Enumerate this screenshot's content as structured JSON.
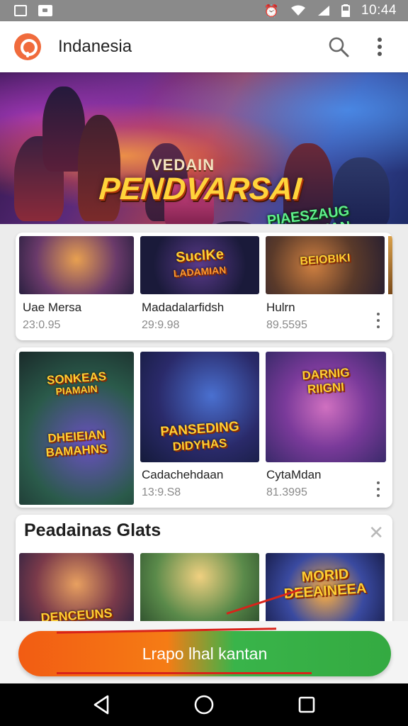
{
  "status_bar": {
    "time": "10:44"
  },
  "app_bar": {
    "title": "Indanesia",
    "icons": [
      "logo-icon",
      "search-icon",
      "more-vert-icon"
    ]
  },
  "banner": {
    "top_text": "VEDAIN",
    "main_text": "PENDVARSAI",
    "side_text_1": "PIAESZAUG",
    "side_text_2": "LESDNSIAN"
  },
  "row1": {
    "items": [
      {
        "title": "Uae Mersa",
        "sub": "23:0.95",
        "thumb_text_1": "",
        "thumb_text_2": ""
      },
      {
        "title": "Madadalarfidsh",
        "sub": "29:9.98",
        "thumb_text_1": "SuclKe",
        "thumb_text_2": "LADAMIAN"
      },
      {
        "title": "Hulrn",
        "sub": "89.5595",
        "thumb_text_1": "BEIOBIKI",
        "thumb_text_2": ""
      }
    ]
  },
  "row2": {
    "items": [
      {
        "title": "",
        "sub": "",
        "thumb_text_1": "SONKEAS",
        "thumb_text_2": "PIAMAIN",
        "thumb_text_3": "DHEIEIAN",
        "thumb_text_4": "BAMAHNS"
      },
      {
        "title": "Cadachehdaan",
        "sub": "13:9.S8",
        "thumb_text_1": "PANSEDING",
        "thumb_text_2": "DIDYHAS"
      },
      {
        "title": "CytaMdan",
        "sub": "81.3995",
        "thumb_text_1": "DARNIG",
        "thumb_text_2": "RIIGNI"
      }
    ]
  },
  "section": {
    "title": "Peadainas Glats",
    "close": "✕",
    "items": [
      {
        "thumb_text_1": "DENCEUNS"
      },
      {
        "thumb_text_1": ""
      },
      {
        "thumb_text_1": "MORID",
        "thumb_text_2": "DEEAINEEA"
      }
    ]
  },
  "cta": {
    "label": "Lrapo lhal kantan"
  },
  "colors": {
    "accent_orange": "#f25c13",
    "accent_green": "#34aa41",
    "logo": "#f06b3c",
    "status_bar": "#8a8a8a"
  }
}
